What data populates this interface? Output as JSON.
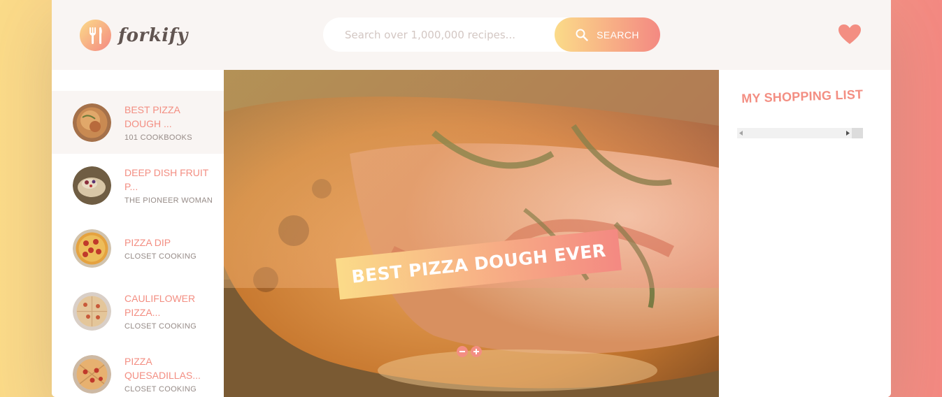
{
  "header": {
    "logo_text": "forkify",
    "search": {
      "placeholder": "Search over 1,000,000 recipes...",
      "value": ""
    },
    "search_button_label": "SEARCH",
    "likes_icon": "heart-icon"
  },
  "results": [
    {
      "title": "BEST PIZZA DOUGH ...",
      "publisher": "101 COOKBOOKS",
      "active": true
    },
    {
      "title": "DEEP DISH FRUIT P...",
      "publisher": "THE PIONEER WOMAN",
      "active": false
    },
    {
      "title": "PIZZA DIP",
      "publisher": "CLOSET COOKING",
      "active": false
    },
    {
      "title": "CAULIFLOWER PIZZA...",
      "publisher": "CLOSET COOKING",
      "active": false
    },
    {
      "title": "PIZZA QUESADILLAS...",
      "publisher": "CLOSET COOKING",
      "active": false
    }
  ],
  "recipe": {
    "title": "BEST PIZZA DOUGH EVER",
    "decrease_icon": "minus-circle-icon",
    "increase_icon": "plus-circle-icon"
  },
  "shopping": {
    "heading": "MY SHOPPING LIST"
  },
  "colors": {
    "accent": "#f38e82",
    "gradient_start": "#fbdb89",
    "gradient_end": "#f48982",
    "header_bg": "#f9f5f3"
  }
}
